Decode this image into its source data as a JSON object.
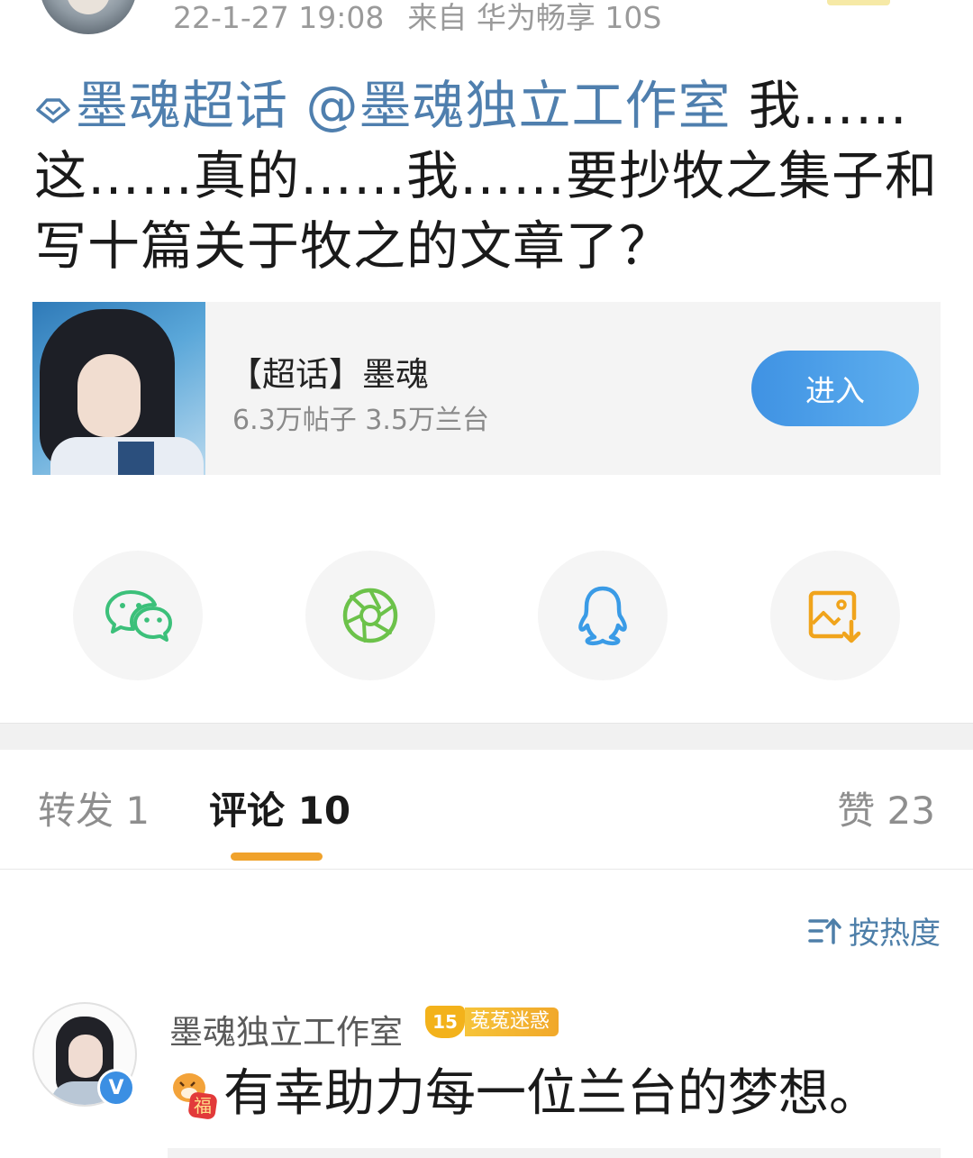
{
  "post": {
    "timestamp": "22-1-27 19:08",
    "source": "来自 华为畅享 10S",
    "topic": "墨魂超话",
    "mention": "@墨魂独立工作室",
    "body": " 我……这……真的……我……要抄牧之集子和写十篇关于牧之的文章了？"
  },
  "topic_card": {
    "title": "【超话】墨魂",
    "stats": "6.3万帖子 3.5万兰台",
    "enter_label": "进入"
  },
  "share": {
    "icons": [
      "wechat-icon",
      "moments-icon",
      "qq-icon",
      "save-image-icon"
    ],
    "colors": {
      "wechat": "#3cc07a",
      "moments": "#6cc24a",
      "qq": "#3a9be6",
      "save": "#f0a41c"
    }
  },
  "tabs": {
    "repost": "转发 1",
    "comment": "评论 10",
    "like": "赞 23"
  },
  "sort": {
    "label": "按热度"
  },
  "comments": [
    {
      "author": "墨魂独立工作室",
      "level": "15",
      "badge": "菟菟迷惑",
      "sticker_text": "福",
      "text": "有幸助力每一位兰台的梦想。"
    }
  ],
  "accent_colors": {
    "link": "#4f7fae",
    "tab_underline": "#f0a22b",
    "enter_button": "#4a9de8"
  }
}
